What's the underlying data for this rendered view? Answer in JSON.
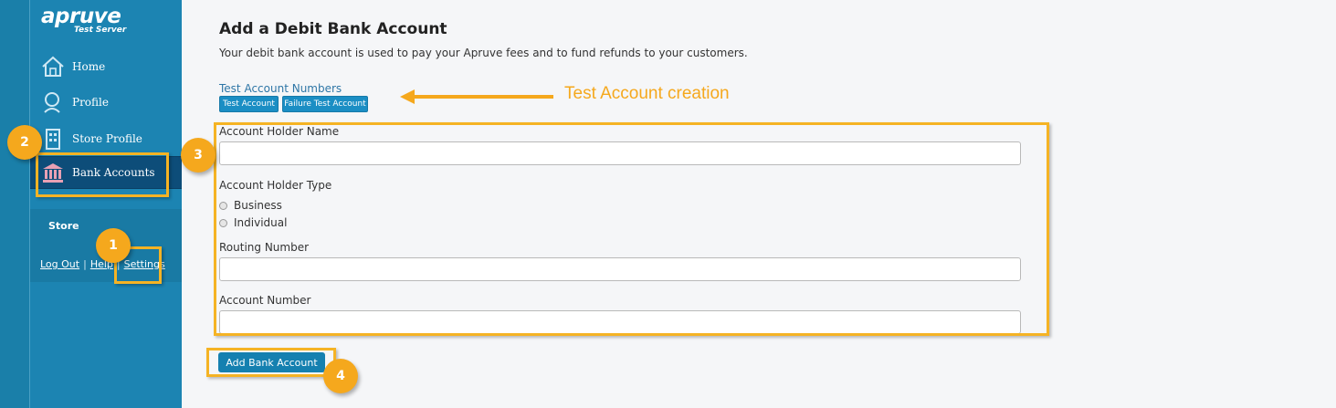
{
  "logo": {
    "brand": "apruve",
    "subtitle": "Test Server"
  },
  "sidebar": {
    "items": [
      {
        "label": "Home"
      },
      {
        "label": "Profile"
      },
      {
        "label": "Store Profile"
      },
      {
        "label": "Bank Accounts"
      }
    ],
    "store_label": "Store",
    "links": {
      "logout": "Log Out",
      "help": "Help",
      "settings": "Settings",
      "separator": "|"
    }
  },
  "main": {
    "title": "Add a Debit Bank Account",
    "description": "Your debit bank account is used to pay your Apruve fees and to fund refunds to your customers.",
    "test_link": "Test Account Numbers",
    "test_buttons": [
      "Test Account",
      "Failure Test Account"
    ],
    "form": {
      "holder_name_label": "Account Holder Name",
      "holder_name_value": "",
      "holder_type_label": "Account Holder Type",
      "holder_type_options": [
        "Business",
        "Individual"
      ],
      "routing_label": "Routing Number",
      "routing_value": "",
      "account_number_label": "Account Number",
      "account_number_value": ""
    },
    "submit_label": "Add Bank Account"
  },
  "annotations": {
    "callout": "Test Account creation",
    "badges": [
      "1",
      "2",
      "3",
      "4"
    ],
    "accent_color": "#f5a81d"
  },
  "colors": {
    "sidebar": "#1c84b2",
    "active_nav": "#0d4d79",
    "button": "#1580b0"
  }
}
